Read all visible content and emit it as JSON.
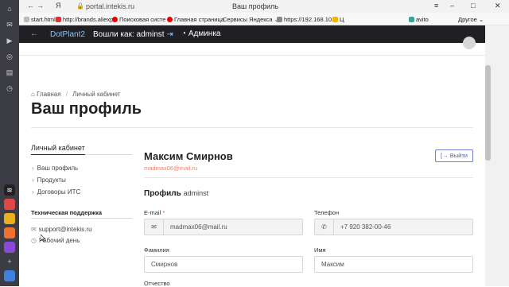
{
  "browser": {
    "url": "portal.intekis.ru",
    "window_title": "Ваш профиль",
    "bookmarks": [
      "start.html",
      "http://brands.aliexp",
      "Поисковая систе",
      "Главная страница",
      "Сервисы Яндекса",
      "https://192.168.10.",
      "Ц",
      "avito",
      "Другое"
    ]
  },
  "topnav": {
    "back": "←",
    "brand": "DotPlant2",
    "user": "Вошли как: adminst",
    "admin": "Админка"
  },
  "breadcrumb": {
    "home": "Главная",
    "current": "Личный кабинет"
  },
  "page_title": "Ваш профиль",
  "cabinet": {
    "title": "Личный кабинет",
    "items": [
      "Ваш профиль",
      "Продукты",
      "Договоры ИТС"
    ]
  },
  "support": {
    "title": "Техническая поддержка",
    "email": "support@intekis.ru",
    "hours": "Рабочий день"
  },
  "profile": {
    "name": "Максим Смирнов",
    "email": "madmax06@mail.ru",
    "logout_label": "Выйти",
    "section_title": "Профиль",
    "section_login": "adminst"
  },
  "fields": {
    "email_label": "E-mail",
    "email_required": "*",
    "email_value": "madmax06@mail.ru",
    "phone_label": "Телефон",
    "phone_value": "+7 920 382-00-46",
    "surname_label": "Фамилия",
    "surname_value": "Смирнов",
    "firstname_label": "Имя",
    "firstname_value": "Максим",
    "patronymic_label": "Отчество"
  },
  "colors": {
    "accent": "#4a5fb0",
    "email_sub": "#e8836f",
    "nav_bg": "#1f1f24"
  }
}
